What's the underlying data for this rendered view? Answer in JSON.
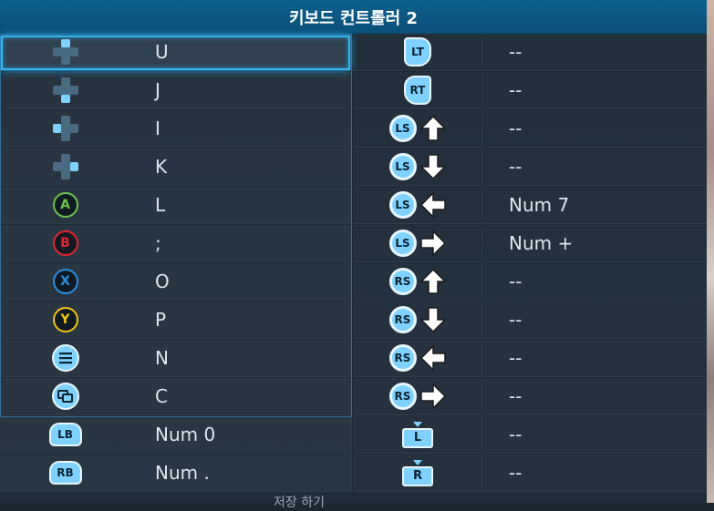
{
  "title": "키보드 컨트롤러 2",
  "rows": [
    {
      "left_icon": "dpad-up-icon",
      "left_key": "U",
      "right_icon": "lt-trigger-icon",
      "right_label": "LT",
      "right_key": "--"
    },
    {
      "left_icon": "dpad-down-icon",
      "left_key": "J",
      "right_icon": "rt-trigger-icon",
      "right_label": "RT",
      "right_key": "--"
    },
    {
      "left_icon": "dpad-left-icon",
      "left_key": "I",
      "right_icon": "ls-up-icon",
      "right_label": "LS",
      "right_key": "--"
    },
    {
      "left_icon": "dpad-right-icon",
      "left_key": "K",
      "right_icon": "ls-down-icon",
      "right_label": "LS",
      "right_key": "--"
    },
    {
      "left_icon": "a-button-icon",
      "left_label": "A",
      "left_key": "L",
      "right_icon": "ls-left-icon",
      "right_label": "LS",
      "right_key": "Num 7"
    },
    {
      "left_icon": "b-button-icon",
      "left_label": "B",
      "left_key": ";",
      "right_icon": "ls-right-icon",
      "right_label": "LS",
      "right_key": "Num +"
    },
    {
      "left_icon": "x-button-icon",
      "left_label": "X",
      "left_key": "O",
      "right_icon": "rs-up-icon",
      "right_label": "RS",
      "right_key": "--"
    },
    {
      "left_icon": "y-button-icon",
      "left_label": "Y",
      "left_key": "P",
      "right_icon": "rs-down-icon",
      "right_label": "RS",
      "right_key": "--"
    },
    {
      "left_icon": "menu-button-icon",
      "left_key": "N",
      "right_icon": "rs-left-icon",
      "right_label": "RS",
      "right_key": "--"
    },
    {
      "left_icon": "view-button-icon",
      "left_key": "C",
      "right_icon": "rs-right-icon",
      "right_label": "RS",
      "right_key": "--"
    },
    {
      "left_icon": "lb-bumper-icon",
      "left_label": "LB",
      "left_key": "Num 0",
      "right_icon": "l-clickpad-icon",
      "right_label": "L",
      "right_key": "--"
    },
    {
      "left_icon": "rb-bumper-icon",
      "left_label": "RB",
      "left_key": "Num .",
      "right_icon": "r-clickpad-icon",
      "right_label": "R",
      "right_key": "--"
    }
  ],
  "colors": {
    "header": "#0d5f8e",
    "focus": "#2fb6f0",
    "icon_fill": "#7fd2ff",
    "a": "#6cc24a",
    "b": "#e0262f",
    "x": "#2a8fe0",
    "y": "#f2c414"
  },
  "footer_text": "저장 하기"
}
